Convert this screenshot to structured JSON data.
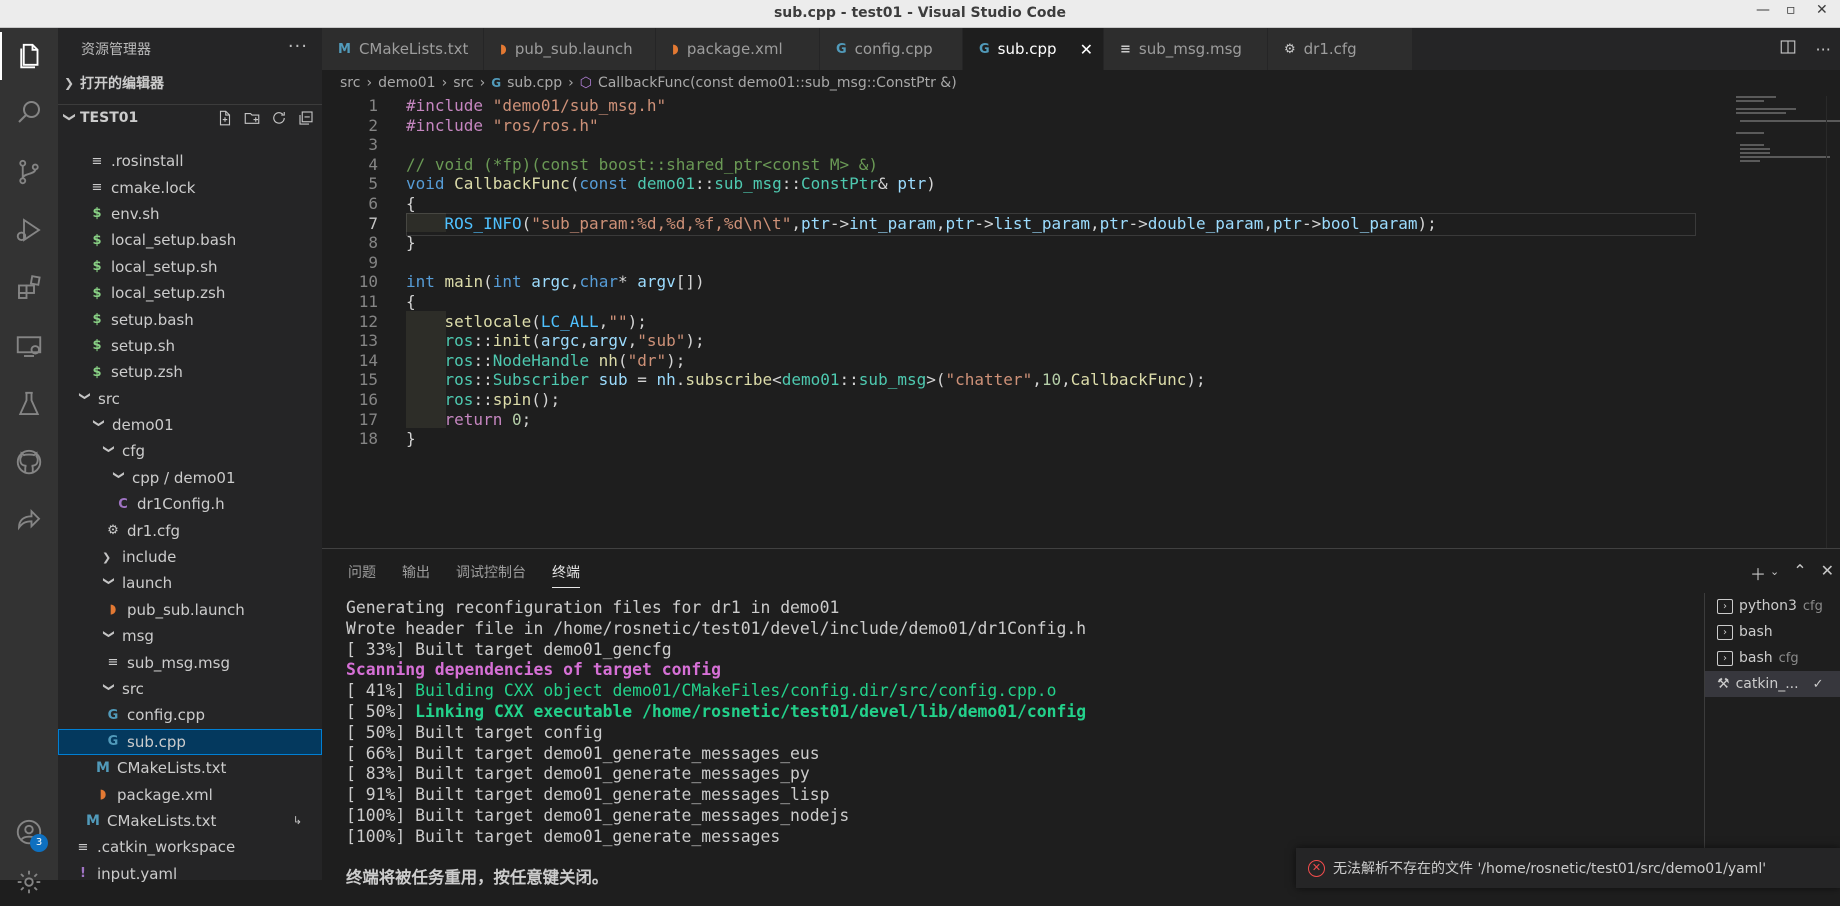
{
  "window": {
    "title": "sub.cpp - test01 - Visual Studio Code",
    "controls": [
      "—",
      "▫",
      "✕"
    ]
  },
  "activity_bar": {
    "accounts_badge": "3"
  },
  "sidebar": {
    "title": "资源管理器",
    "more": "···",
    "open_editors": "打开的编辑器",
    "workspace": "TEST01",
    "items": [
      {
        "label": ".rosinstall",
        "icon": "lines",
        "depth": 1
      },
      {
        "label": "cmake.lock",
        "icon": "lines",
        "depth": 1
      },
      {
        "label": "env.sh",
        "icon": "dollar",
        "depth": 1
      },
      {
        "label": "local_setup.bash",
        "icon": "dollar",
        "depth": 1
      },
      {
        "label": "local_setup.sh",
        "icon": "dollar",
        "depth": 1
      },
      {
        "label": "local_setup.zsh",
        "icon": "dollar",
        "depth": 1
      },
      {
        "label": "setup.bash",
        "icon": "dollar",
        "depth": 1
      },
      {
        "label": "setup.sh",
        "icon": "dollar",
        "depth": 1
      },
      {
        "label": "setup.zsh",
        "icon": "dollar",
        "depth": 1
      },
      {
        "label": "src",
        "icon": "folder",
        "depth": 0
      },
      {
        "label": "demo01",
        "icon": "folder",
        "depth": 1
      },
      {
        "label": "cfg",
        "icon": "folder",
        "depth": 2
      },
      {
        "label": "cpp / demo01",
        "icon": "folder",
        "depth": 3
      },
      {
        "label": "dr1Config.h",
        "icon": "c",
        "depth": 4
      },
      {
        "label": "dr1.cfg",
        "icon": "gear",
        "depth": 3
      },
      {
        "label": "include",
        "icon": "folder-closed",
        "depth": 2
      },
      {
        "label": "launch",
        "icon": "folder",
        "depth": 2
      },
      {
        "label": "pub_sub.launch",
        "icon": "rss",
        "depth": 3
      },
      {
        "label": "msg",
        "icon": "folder",
        "depth": 2
      },
      {
        "label": "sub_msg.msg",
        "icon": "lines",
        "depth": 3
      },
      {
        "label": "src",
        "icon": "folder",
        "depth": 2
      },
      {
        "label": "config.cpp",
        "icon": "cpp",
        "depth": 3
      },
      {
        "label": "sub.cpp",
        "icon": "cpp",
        "depth": 3,
        "selected": true
      },
      {
        "label": "CMakeLists.txt",
        "icon": "m",
        "depth": 2
      },
      {
        "label": "package.xml",
        "icon": "rss",
        "depth": 2
      },
      {
        "label": "CMakeLists.txt",
        "icon": "m",
        "depth": 1,
        "suffix": "↳"
      },
      {
        "label": ".catkin_workspace",
        "icon": "lines",
        "depth": 0
      },
      {
        "label": "input.yaml",
        "icon": "excl",
        "depth": 0
      }
    ]
  },
  "tabs": [
    {
      "label": "CMakeLists.txt",
      "icon": "M",
      "color": "#519aba",
      "width": 162
    },
    {
      "label": "pub_sub.launch",
      "icon": "◗",
      "color": "#e37933",
      "width": 172
    },
    {
      "label": "package.xml",
      "icon": "◗",
      "color": "#e37933",
      "width": 164
    },
    {
      "label": "config.cpp",
      "icon": "G",
      "color": "#519aba",
      "width": 143
    },
    {
      "label": "sub.cpp",
      "icon": "G",
      "color": "#519aba",
      "width": 141,
      "active": true
    },
    {
      "label": "sub_msg.msg",
      "icon": "≡",
      "color": "#cccccc",
      "width": 164
    },
    {
      "label": "dr1.cfg",
      "icon": "⚙",
      "color": "#cccccc",
      "width": 145
    }
  ],
  "breadcrumbs": [
    "src",
    "demo01",
    "src",
    "sub.cpp",
    "CallbackFunc(const demo01::sub_msg::ConstPtr &)"
  ],
  "editor": {
    "current_line": 7,
    "lines": [
      [
        [
          "kc",
          "#include"
        ],
        [
          "",
          ""
        ],
        [
          "s",
          " \"demo01/sub_msg.h\""
        ]
      ],
      [
        [
          "kc",
          "#include"
        ],
        [
          "s",
          " \"ros/ros.h\""
        ]
      ],
      [],
      [
        [
          "c",
          "// void (*fp)(const boost::shared_ptr<const M> &)"
        ]
      ],
      [
        [
          "k",
          "void"
        ],
        [
          "",
          " "
        ],
        [
          "f",
          "CallbackFunc"
        ],
        [
          "",
          "("
        ],
        [
          "k",
          "const"
        ],
        [
          "",
          " "
        ],
        [
          "t",
          "demo01"
        ],
        [
          "",
          "::"
        ],
        [
          "t",
          "sub_msg"
        ],
        [
          "",
          "::"
        ],
        [
          "t",
          "ConstPtr"
        ],
        [
          "",
          "& "
        ],
        [
          "v",
          "ptr"
        ],
        [
          "",
          ")"
        ]
      ],
      [
        [
          "",
          "{"
        ]
      ],
      [
        [
          "",
          "    "
        ],
        [
          "m",
          "ROS_INFO"
        ],
        [
          "",
          "("
        ],
        [
          "s",
          "\"sub_param:%d,%d,%f,%d\\n\\t\""
        ],
        [
          "",
          ","
        ],
        [
          "v",
          "ptr"
        ],
        [
          "",
          "->"
        ],
        [
          "v",
          "int_param"
        ],
        [
          "",
          ","
        ],
        [
          "v",
          "ptr"
        ],
        [
          "",
          "->"
        ],
        [
          "v",
          "list_param"
        ],
        [
          "",
          ","
        ],
        [
          "v",
          "ptr"
        ],
        [
          "",
          "->"
        ],
        [
          "v",
          "double_param"
        ],
        [
          "",
          ","
        ],
        [
          "v",
          "ptr"
        ],
        [
          "",
          "->"
        ],
        [
          "v",
          "bool_param"
        ],
        [
          "",
          ");"
        ]
      ],
      [
        [
          "",
          "}"
        ]
      ],
      [],
      [
        [
          "k",
          "int"
        ],
        [
          "",
          " "
        ],
        [
          "f",
          "main"
        ],
        [
          "",
          "("
        ],
        [
          "k",
          "int"
        ],
        [
          "",
          " "
        ],
        [
          "v",
          "argc"
        ],
        [
          "",
          ","
        ],
        [
          "k",
          "char"
        ],
        [
          "",
          "* "
        ],
        [
          "v",
          "argv"
        ],
        [
          "",
          "[])"
        ]
      ],
      [
        [
          "",
          "{"
        ]
      ],
      [
        [
          "",
          "    "
        ],
        [
          "f",
          "setlocale"
        ],
        [
          "",
          "("
        ],
        [
          "m",
          "LC_ALL"
        ],
        [
          "",
          ","
        ],
        [
          "s",
          "\"\""
        ],
        [
          "",
          ");"
        ]
      ],
      [
        [
          "",
          "    "
        ],
        [
          "t",
          "ros"
        ],
        [
          "",
          "::"
        ],
        [
          "f",
          "init"
        ],
        [
          "",
          "("
        ],
        [
          "v",
          "argc"
        ],
        [
          "",
          ","
        ],
        [
          "v",
          "argv"
        ],
        [
          "",
          ","
        ],
        [
          "s",
          "\"sub\""
        ],
        [
          "",
          ");"
        ]
      ],
      [
        [
          "",
          "    "
        ],
        [
          "t",
          "ros"
        ],
        [
          "",
          "::"
        ],
        [
          "t",
          "NodeHandle"
        ],
        [
          "",
          " "
        ],
        [
          "f",
          "nh"
        ],
        [
          "",
          "("
        ],
        [
          "s",
          "\"dr\""
        ],
        [
          "",
          ");"
        ]
      ],
      [
        [
          "",
          "    "
        ],
        [
          "t",
          "ros"
        ],
        [
          "",
          "::"
        ],
        [
          "t",
          "Subscriber"
        ],
        [
          "",
          " "
        ],
        [
          "v",
          "sub"
        ],
        [
          "",
          " = "
        ],
        [
          "v",
          "nh"
        ],
        [
          "",
          "."
        ],
        [
          "f",
          "subscribe"
        ],
        [
          "",
          "<"
        ],
        [
          "t",
          "demo01"
        ],
        [
          "",
          "::"
        ],
        [
          "t",
          "sub_msg"
        ],
        [
          "",
          ">("
        ],
        [
          "s",
          "\"chatter\""
        ],
        [
          "",
          ","
        ],
        [
          "n",
          "10"
        ],
        [
          "",
          ","
        ],
        [
          "f",
          "CallbackFunc"
        ],
        [
          "",
          ");"
        ]
      ],
      [
        [
          "",
          "    "
        ],
        [
          "t",
          "ros"
        ],
        [
          "",
          "::"
        ],
        [
          "f",
          "spin"
        ],
        [
          "",
          "();"
        ]
      ],
      [
        [
          "",
          "    "
        ],
        [
          "kc",
          "return"
        ],
        [
          "",
          " "
        ],
        [
          "n",
          "0"
        ],
        [
          "",
          ";"
        ]
      ],
      [
        [
          "",
          "}"
        ]
      ]
    ]
  },
  "panel": {
    "tabs": [
      "问题",
      "输出",
      "调试控制台",
      "终端"
    ],
    "active_tab": "终端",
    "terminal_lines": [
      [
        [
          "",
          "Generating reconfiguration files for dr1 in demo01"
        ]
      ],
      [
        [
          "",
          "Wrote header file in /home/rosnetic/test01/devel/include/demo01/dr1Config.h"
        ]
      ],
      [
        [
          "",
          "[ 33%] Built target demo01_gencfg"
        ]
      ],
      [
        [
          "pb",
          "Scanning dependencies of target config"
        ]
      ],
      [
        [
          "",
          "[ 41%] "
        ],
        [
          "g",
          "Building CXX object demo01/CMakeFiles/config.dir/src/config.cpp.o"
        ]
      ],
      [
        [
          "",
          "[ 50%] "
        ],
        [
          "gb",
          "Linking CXX executable /home/rosnetic/test01/devel/lib/demo01/config"
        ]
      ],
      [
        [
          "",
          "[ 50%] Built target config"
        ]
      ],
      [
        [
          "",
          "[ 66%] Built target demo01_generate_messages_eus"
        ]
      ],
      [
        [
          "",
          "[ 83%] Built target demo01_generate_messages_py"
        ]
      ],
      [
        [
          "",
          "[ 91%] Built target demo01_generate_messages_lisp"
        ]
      ],
      [
        [
          "",
          "[100%] Built target demo01_generate_messages_nodejs"
        ]
      ],
      [
        [
          "",
          "[100%] Built target demo01_generate_messages"
        ]
      ],
      [],
      [
        [
          "bold",
          "终端将被任务重用，按任意键关闭。"
        ]
      ]
    ],
    "terminals": [
      {
        "label": "python3",
        "sub": "cfg"
      },
      {
        "label": "bash",
        "sub": ""
      },
      {
        "label": "bash",
        "sub": "cfg"
      },
      {
        "label": "catkin_...",
        "sub": "✓",
        "selected": true
      }
    ]
  },
  "notification": {
    "text": "无法解析不存在的文件 '/home/rosnetic/test01/src/demo01/yaml'"
  }
}
